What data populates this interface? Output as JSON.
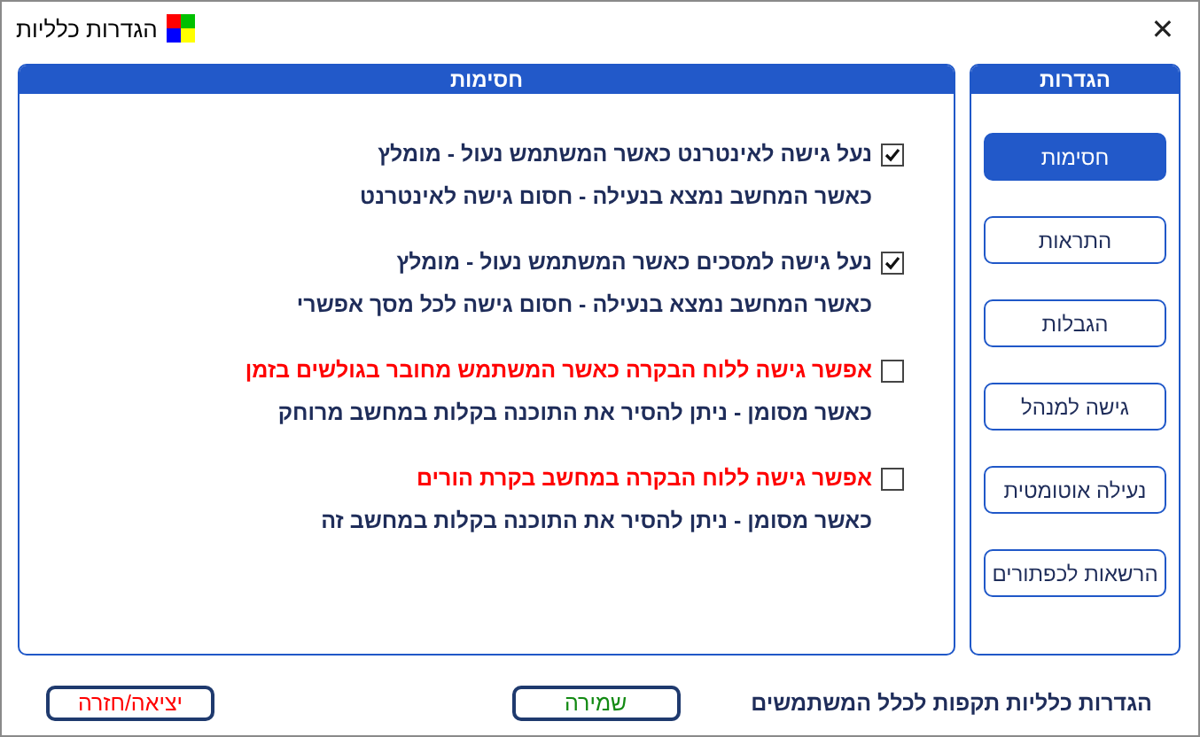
{
  "window": {
    "title": "הגדרות כלליות",
    "close": "✕"
  },
  "blocks_panel": {
    "title": "חסימות",
    "options": [
      {
        "label": "נעל גישה לאינטרנט כאשר המשתמש נעול - מומלץ",
        "description": "כאשר המחשב נמצא בנעילה - חסום גישה לאינטרנט",
        "checked": true,
        "kind": "normal"
      },
      {
        "label": "נעל גישה למסכים כאשר המשתמש נעול - מומלץ",
        "description": "כאשר המחשב נמצא בנעילה - חסום גישה לכל מסך אפשרי",
        "checked": true,
        "kind": "normal"
      },
      {
        "label": "אפשר גישה ללוח הבקרה כאשר המשתמש מחובר בגולשים בזמן",
        "description": "כאשר מסומן - ניתן להסיר את התוכנה בקלות במחשב מרוחק",
        "checked": false,
        "kind": "warning"
      },
      {
        "label": "אפשר גישה ללוח הבקרה במחשב בקרת הורים",
        "description": "כאשר מסומן - ניתן להסיר את התוכנה בקלות במחשב זה",
        "checked": false,
        "kind": "warning"
      }
    ]
  },
  "settings_panel": {
    "title": "הגדרות",
    "items": [
      {
        "label": "חסימות",
        "selected": true
      },
      {
        "label": "התראות",
        "selected": false
      },
      {
        "label": "הגבלות",
        "selected": false
      },
      {
        "label": "גישה למנהל",
        "selected": false
      },
      {
        "label": "נעילה אוטומטית",
        "selected": false
      },
      {
        "label": "הרשאות לכפתורים",
        "selected": false
      }
    ]
  },
  "footer": {
    "note": "הגדרות כלליות תקפות לכלל המשתמשים",
    "save": "שמירה",
    "exit": "יציאה/חזרה"
  }
}
